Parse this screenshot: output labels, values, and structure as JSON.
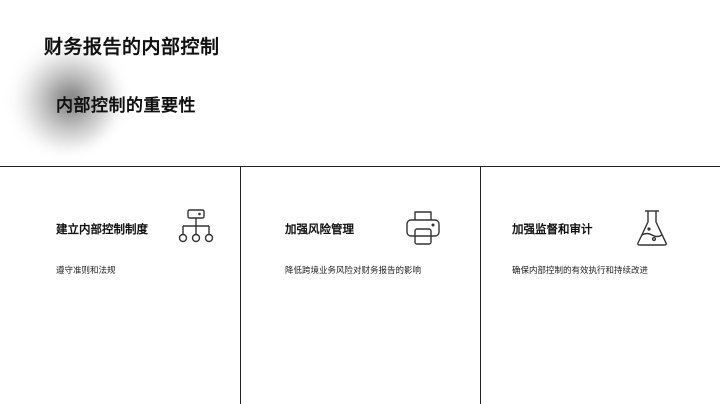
{
  "slide": {
    "title": "财务报告的内部控制",
    "subtitle": "内部控制的重要性"
  },
  "cards": [
    {
      "title": "建立内部控制制度",
      "description": "遵守准则和法规",
      "icon": "hierarchy-icon"
    },
    {
      "title": "加强风险管理",
      "description": "降低跨境业务风险对财务报告的影响",
      "icon": "printer-icon"
    },
    {
      "title": "加强监督和审计",
      "description": "确保内部控制的有效执行和持续改进",
      "icon": "flask-icon"
    }
  ],
  "colors": {
    "text": "#111111",
    "lines": "#222222",
    "background": "#ffffff"
  }
}
